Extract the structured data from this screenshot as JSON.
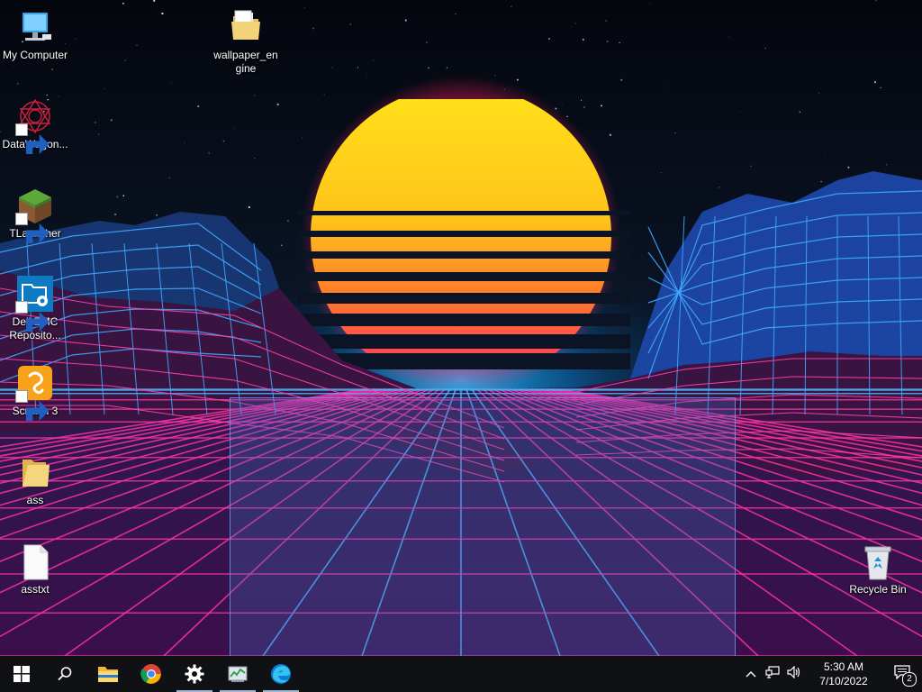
{
  "desktop": {
    "icons": [
      {
        "label": "My Computer",
        "icon": "computer-icon"
      },
      {
        "label": "wallpaper_en gine",
        "icon": "folder-icon"
      },
      {
        "label": "DataWagon...",
        "icon": "datawagon-icon",
        "shortcut": true
      },
      {
        "label": "TLauncher",
        "icon": "minecraft-grass-block-icon",
        "shortcut": true
      },
      {
        "label": "Dell EMC Reposito...",
        "icon": "folder-gear-icon",
        "shortcut": true
      },
      {
        "label": "Scratch 3",
        "icon": "scratch-icon",
        "shortcut": true
      },
      {
        "label": "ass",
        "icon": "folder-icon"
      },
      {
        "label": "asstxt",
        "icon": "text-file-icon"
      },
      {
        "label": "Recycle Bin",
        "icon": "recycle-bin-icon"
      }
    ]
  },
  "taskbar": {
    "start": "windows-start-icon",
    "search": "search-icon",
    "pinned": [
      {
        "icon": "file-explorer-icon"
      },
      {
        "icon": "chrome-icon"
      },
      {
        "icon": "settings-gear-icon",
        "running": true
      },
      {
        "icon": "task-manager-icon",
        "running": true
      },
      {
        "icon": "edge-icon",
        "running": true
      }
    ]
  },
  "tray": {
    "icons": [
      "chevron-up-icon",
      "network-icon",
      "volume-icon"
    ],
    "time": "5:30 AM",
    "date": "7/10/2022",
    "notification_count": "2"
  },
  "colors": {
    "taskbar": "#101114",
    "sun_top": "#ffe21a",
    "sun_bottom": "#ff2a6d",
    "grid_pink": "#ff2fa8",
    "grid_blue": "#2fb2ff"
  }
}
